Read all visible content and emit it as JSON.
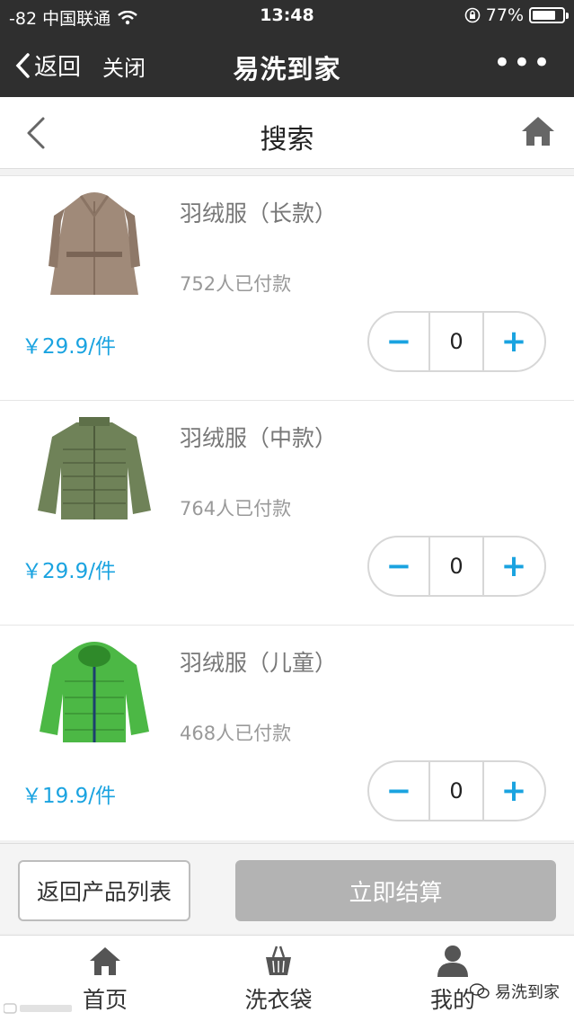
{
  "status_bar": {
    "carrier": "-82 中国联通",
    "time": "13:48",
    "battery": "77%",
    "battery_level": 0.77
  },
  "wechat_nav": {
    "back_label": "返回",
    "close_label": "关闭",
    "title": "易洗到家",
    "more_label": "•••"
  },
  "page_header": {
    "title": "搜索"
  },
  "products": [
    {
      "name": "羽绒服（长款）",
      "sold": "752人已付款",
      "price": "￥29.9/件",
      "qty": "0",
      "image": "long-down-coat"
    },
    {
      "name": "羽绒服（中款）",
      "sold": "764人已付款",
      "price": "￥29.9/件",
      "qty": "0",
      "image": "mid-down-jacket"
    },
    {
      "name": "羽绒服（儿童）",
      "sold": "468人已付款",
      "price": "￥19.9/件",
      "qty": "0",
      "image": "kids-down-jacket"
    }
  ],
  "actions": {
    "back_to_list": "返回产品列表",
    "checkout": "立即结算"
  },
  "tabbar": {
    "home": "首页",
    "bag": "洗衣袋",
    "mine": "我的"
  },
  "watermark": {
    "right": "易洗到家"
  },
  "colors": {
    "accent": "#1aa3e0",
    "header_dark": "#2f2f2f",
    "disabled_button": "#b3b3b3"
  }
}
